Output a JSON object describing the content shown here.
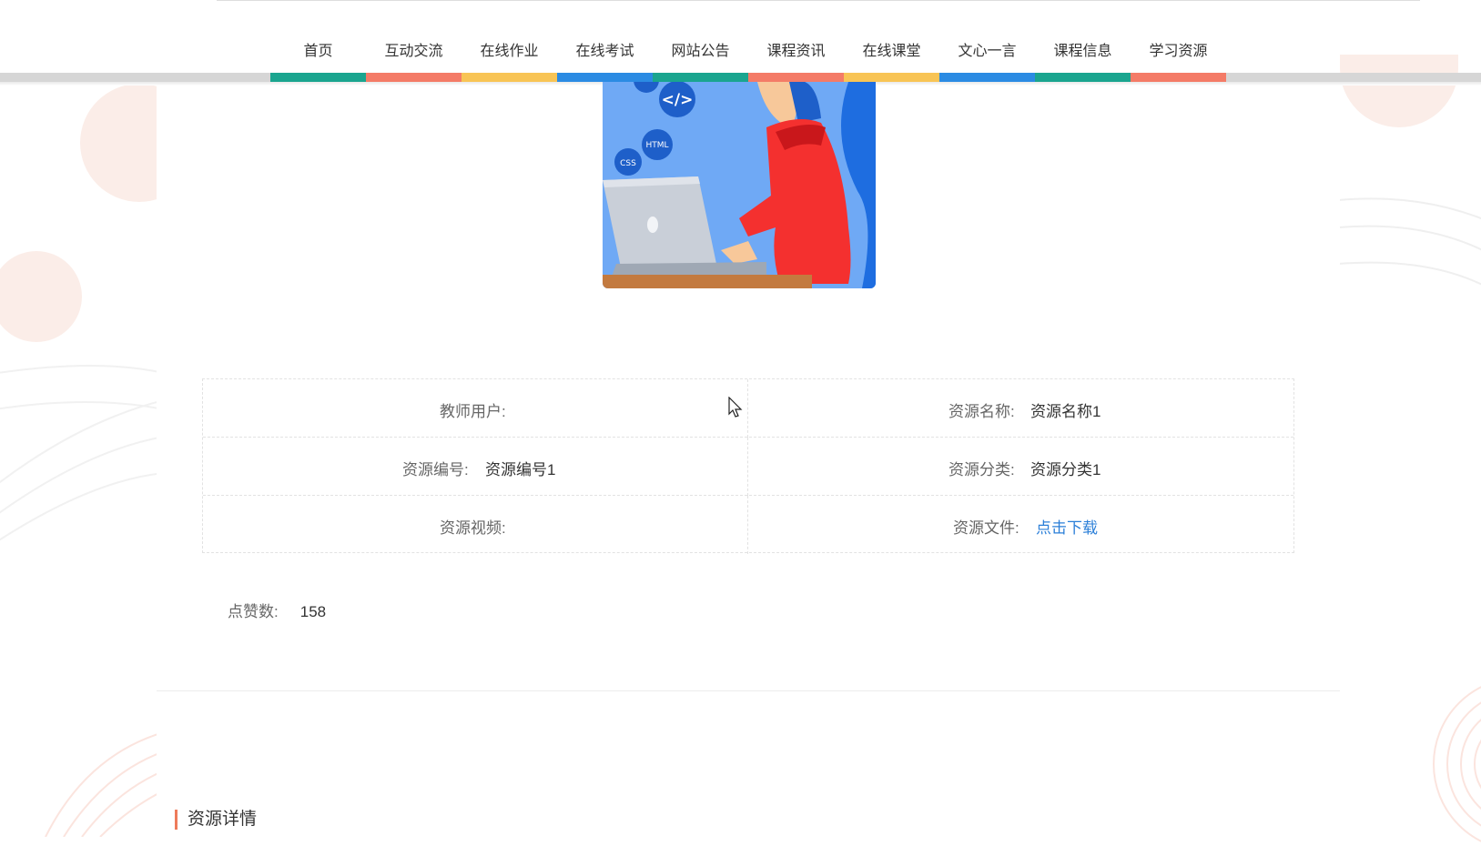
{
  "nav": {
    "items": [
      {
        "label": "首页",
        "color": "#1aa58f"
      },
      {
        "label": "互动交流",
        "color": "#f47b67"
      },
      {
        "label": "在线作业",
        "color": "#f8c455"
      },
      {
        "label": "在线考试",
        "color": "#2b8be3"
      },
      {
        "label": "网站公告",
        "color": "#1aa58f"
      },
      {
        "label": "课程资讯",
        "color": "#f47b67"
      },
      {
        "label": "在线课堂",
        "color": "#f8c455"
      },
      {
        "label": "文心一言",
        "color": "#2b8be3"
      },
      {
        "label": "课程信息",
        "color": "#1aa58f"
      },
      {
        "label": "学习资源",
        "color": "#f47b67"
      }
    ]
  },
  "hero": {
    "icon_code": "</>",
    "icon_html": "HTML",
    "icon_css": "CSS"
  },
  "info": {
    "teacher_label": "教师用户:",
    "teacher_value": "",
    "name_label": "资源名称:",
    "name_value": "资源名称1",
    "code_label": "资源编号:",
    "code_value": "资源编号1",
    "category_label": "资源分类:",
    "category_value": "资源分类1",
    "video_label": "资源视频:",
    "video_value": "",
    "file_label": "资源文件:",
    "file_link": "点击下载"
  },
  "likes": {
    "label": "点赞数:",
    "value": "158"
  },
  "detail": {
    "title": "资源详情"
  },
  "colors": {
    "accent": "#ee7b5b",
    "link": "#2b7fd8",
    "deco": "#fbede8"
  }
}
